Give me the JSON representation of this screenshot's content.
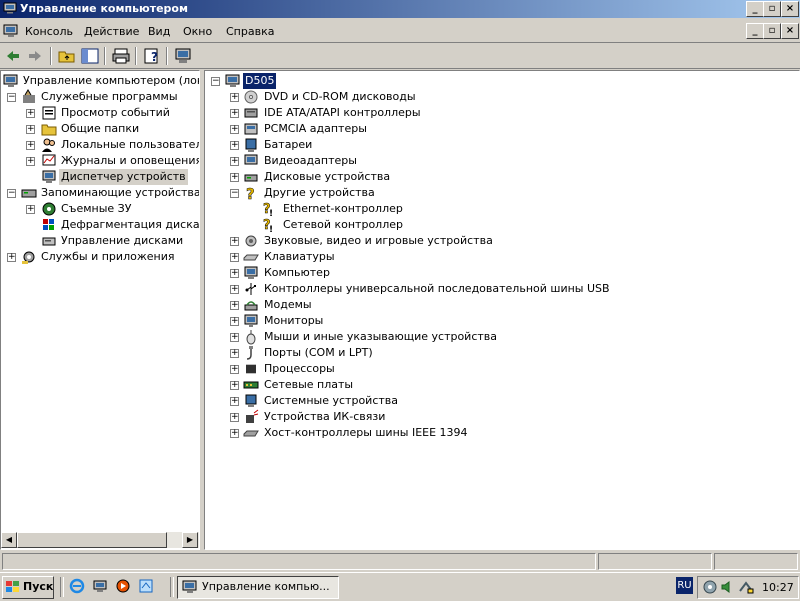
{
  "window": {
    "title": "Управление компьютером",
    "caption_buttons": {
      "minimize": "_",
      "maximize": "▫",
      "close": "×"
    }
  },
  "menu": {
    "items": [
      "Консоль",
      "Действие",
      "Вид",
      "Окно",
      "Справка"
    ]
  },
  "left_tree": {
    "root": "Управление компьютером (локаль",
    "items": [
      {
        "label": "Служебные программы"
      },
      {
        "label": "Просмотр событий"
      },
      {
        "label": "Общие папки"
      },
      {
        "label": "Локальные пользователи и"
      },
      {
        "label": "Журналы и оповещения пр"
      },
      {
        "label": "Диспетчер устройств"
      },
      {
        "label": "Запоминающие устройства"
      },
      {
        "label": "Съемные ЗУ"
      },
      {
        "label": "Дефрагментация диска"
      },
      {
        "label": "Управление дисками"
      },
      {
        "label": "Службы и приложения"
      }
    ]
  },
  "device_tree": {
    "root": "D505",
    "categories": [
      "DVD и CD-ROM дисководы",
      "IDE ATA/ATAPI контроллеры",
      "PCMCIA адаптеры",
      "Батареи",
      "Видеоадаптеры",
      "Дисковые устройства",
      "Другие устройства",
      "Ethernet-контроллер",
      "Сетевой контроллер",
      "Звуковые, видео и игровые устройства",
      "Клавиатуры",
      "Компьютер",
      "Контроллеры универсальной последовательной шины USB",
      "Модемы",
      "Мониторы",
      "Мыши и иные указывающие устройства",
      "Порты (COM и LPT)",
      "Процессоры",
      "Сетевые платы",
      "Системные устройства",
      "Устройства ИК-связи",
      "Хост-контроллеры шины IEEE 1394"
    ]
  },
  "taskbar": {
    "start_label": "Пуск",
    "task_label": "Управление компью...",
    "lang": "RU",
    "clock": "10:27"
  }
}
